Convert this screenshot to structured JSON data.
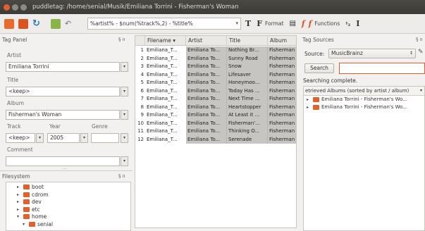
{
  "window": {
    "title": "puddletag: /home/senial/Musik/Emiliana Torrini - Fisherman's Woman"
  },
  "toolbar": {
    "pattern": "%artist% - $num(%track%,2) - %title%",
    "format_label": "Format",
    "functions_label": "Functions"
  },
  "tag_panel": {
    "title": "Tag Panel",
    "pin": "§ ıı",
    "artist_label": "Artist",
    "artist_value": "Emiliana Torrini",
    "title_label": "Title",
    "title_value": "<keep>",
    "album_label": "Album",
    "album_value": "Fisherman's Woman",
    "track_label": "Track",
    "year_label": "Year",
    "genre_label": "Genre",
    "track_value": "<keep>",
    "year_value": "2005",
    "genre_value": "",
    "comment_label": "Comment",
    "comment_value": ""
  },
  "filesystem": {
    "title": "Filesystem",
    "pin": "§ ıı",
    "items": [
      {
        "label": "boot",
        "expanded": false
      },
      {
        "label": "cdrom",
        "expanded": false
      },
      {
        "label": "dev",
        "expanded": false
      },
      {
        "label": "etc",
        "expanded": false
      },
      {
        "label": "home",
        "expanded": true
      },
      {
        "label": "senial",
        "expanded": true
      }
    ]
  },
  "table": {
    "columns": [
      "Filename",
      "Artist",
      "Title",
      "Album"
    ],
    "rows": [
      {
        "n": "1",
        "filename": "Emiliana_T...",
        "artist": "Emiliana To...",
        "title": "Nothing Br...",
        "album": "Fisherman"
      },
      {
        "n": "2",
        "filename": "Emiliana_T...",
        "artist": "Emiliana To...",
        "title": "Sunny Road",
        "album": "Fisherman"
      },
      {
        "n": "3",
        "filename": "Emiliana_T...",
        "artist": "Emiliana To...",
        "title": "Snow",
        "album": "Fisherman"
      },
      {
        "n": "4",
        "filename": "Emiliana_T...",
        "artist": "Emiliana To...",
        "title": "Lifesaver",
        "album": "Fisherman"
      },
      {
        "n": "5",
        "filename": "Emiliana_T...",
        "artist": "Emiliana To...",
        "title": "Honeymoo...",
        "album": "Fisherman"
      },
      {
        "n": "6",
        "filename": "Emiliana_T...",
        "artist": "Emiliana To...",
        "title": "Today Has ...",
        "album": "Fisherman"
      },
      {
        "n": "7",
        "filename": "Emiliana_T...",
        "artist": "Emiliana To...",
        "title": "Next Time ...",
        "album": "Fisherman"
      },
      {
        "n": "8",
        "filename": "Emiliana_T...",
        "artist": "Emiliana To...",
        "title": "Heartstopper",
        "album": "Fisherman"
      },
      {
        "n": "9",
        "filename": "Emiliana_T...",
        "artist": "Emiliana To...",
        "title": "At Least it ...",
        "album": "Fisherman"
      },
      {
        "n": "10",
        "filename": "Emiliana_T...",
        "artist": "Emiliana To...",
        "title": "Fisherman'...",
        "album": "Fisherman"
      },
      {
        "n": "11",
        "filename": "Emiliana_T...",
        "artist": "Emiliana To...",
        "title": "Thinking O...",
        "album": "Fisherman"
      },
      {
        "n": "12",
        "filename": "Emiliana_T...",
        "artist": "Emiliana To...",
        "title": "Serenade",
        "album": "Fisherman"
      }
    ]
  },
  "tag_sources": {
    "title": "Tag Sources",
    "pin": "§ ıı",
    "source_label": "Source:",
    "source_value": "MusicBrainz",
    "search_label": "Search",
    "status": "Searching complete.",
    "list_header": "etrieved Albums (sorted by artist / album)",
    "albums": [
      "Emiliana Torrini - Fisherman's Wo...",
      "Emiliana Torrini - Fisherman's Wo..."
    ]
  },
  "colors": {
    "accent": "#e05e2f",
    "folder": "#e1602c",
    "titlebar": "#3c3b37",
    "selected_cell": "#c7c5c1"
  }
}
